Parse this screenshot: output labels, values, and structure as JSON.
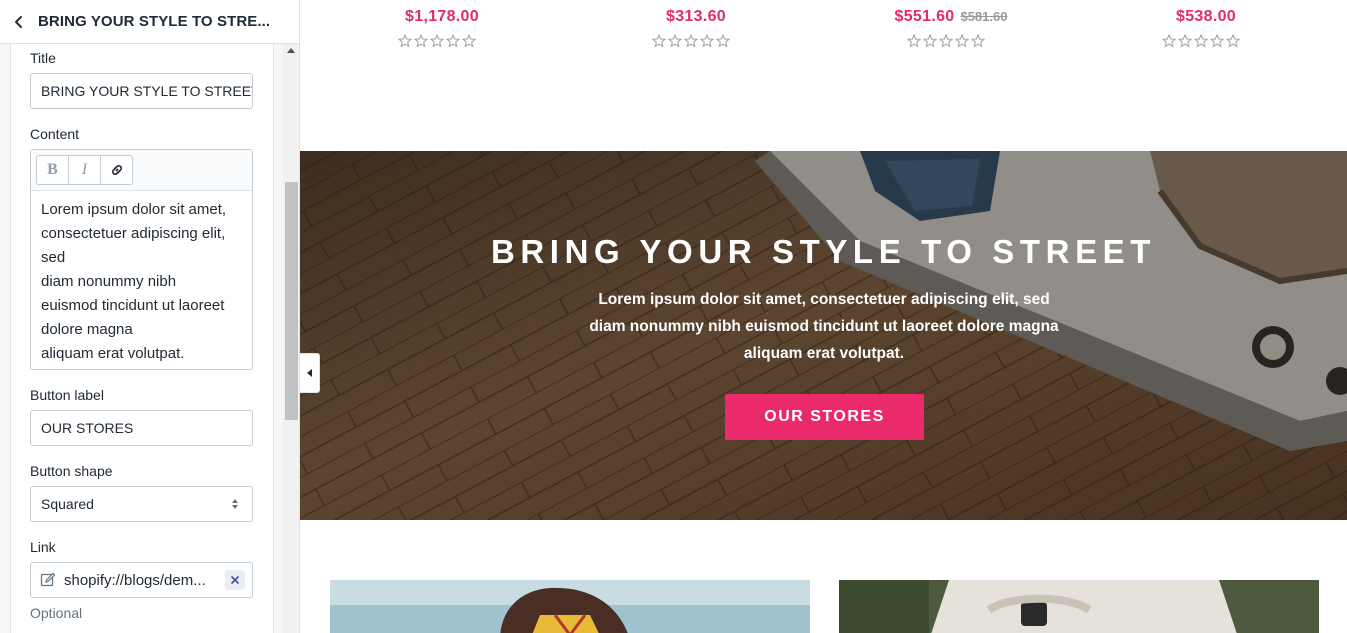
{
  "sidebar": {
    "header_title": "BRING YOUR STYLE TO STRE...",
    "fields": {
      "title_label": "Title",
      "title_value": "BRING YOUR STYLE TO STREET",
      "content_label": "Content",
      "content_lines": [
        "Lorem ipsum dolor sit amet,",
        "consectetuer adipiscing elit,",
        "sed",
        "diam nonummy nibh",
        "euismod tincidunt ut laoreet",
        "dolore magna",
        "aliquam erat volutpat."
      ],
      "rte_bold": "B",
      "rte_italic": "I",
      "button_label_label": "Button label",
      "button_label_value": "OUR STORES",
      "button_shape_label": "Button shape",
      "button_shape_value": "Squared",
      "link_label": "Link",
      "link_value": "shopify://blogs/dem...",
      "link_hint": "Optional"
    }
  },
  "preview": {
    "products": [
      {
        "price": "$1,178.00",
        "old_price": "",
        "rating": 0
      },
      {
        "price": "$313.60",
        "old_price": "",
        "rating": 0
      },
      {
        "price": "$551.60",
        "old_price": "$581.60",
        "rating": 0
      },
      {
        "price": "$538.00",
        "old_price": "",
        "rating": 0
      }
    ],
    "banner": {
      "title": "BRING YOUR STYLE TO STREET",
      "text_lines": [
        "Lorem ipsum dolor sit amet, consectetuer adipiscing elit, sed",
        "diam nonummy nibh euismod tincidunt ut laoreet dolore magna",
        "aliquam erat volutpat."
      ],
      "button": "OUR STORES"
    }
  },
  "colors": {
    "accent_pink": "#e32a6c",
    "button_pink": "#ea2a6b",
    "old_price_gray": "#999999"
  },
  "icons": [
    "chevron-left-icon",
    "link-icon",
    "edit-icon",
    "close-icon",
    "star-outline-icon",
    "collapse-arrow-icon",
    "select-arrows-icon"
  ]
}
